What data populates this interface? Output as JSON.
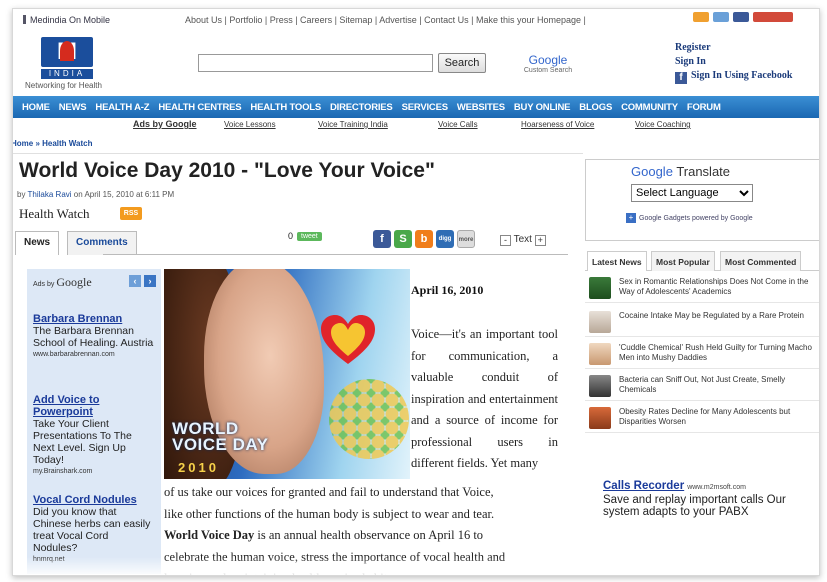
{
  "header": {
    "site_name": "Medindia On Mobile",
    "top_links": "About Us | Portfolio | Press | Careers | Sitemap | Advertise | Contact Us |  Make this your Homepage |",
    "logo_text": "M",
    "logo_country": "INDIA",
    "logo_tagline": "Networking for Health",
    "search_button": "Search",
    "custom_search_brand": "Google",
    "custom_search_label": "Custom Search",
    "register": "Register",
    "sign_in": "Sign In",
    "sign_in_facebook": "Sign In Using Facebook"
  },
  "nav": {
    "items": [
      "HOME",
      "NEWS",
      "HEALTH A-Z",
      "HEALTH CENTRES",
      "HEALTH TOOLS",
      "DIRECTORIES",
      "SERVICES",
      "WEBSITES",
      "BUY ONLINE",
      "BLOGS",
      "COMMUNITY",
      "FORUM"
    ]
  },
  "ad_links": {
    "label": "Ads by Google",
    "items": [
      "Voice Lessons",
      "Voice Training India",
      "Voice Calls",
      "Hoarseness of Voice",
      "Voice Coaching"
    ]
  },
  "breadcrumb": "Home » Health Watch",
  "article": {
    "title": "World Voice Day 2010 - \"Love Your Voice\"",
    "byline_prefix": "by ",
    "author": "Thilaka Ravi",
    "byline_suffix": " on  April 15, 2010 at 6:11 PM",
    "section": "Health Watch",
    "rss": "RSS",
    "tab_news": "News",
    "tab_comments": "Comments",
    "tweet_count": "0",
    "tweet_label": "tweet",
    "text_size_minus": "-",
    "text_size_label": "Text",
    "text_size_plus": "+",
    "date": "April 16, 2010",
    "para_narrow": "Voice—it's an important tool for communication, a valuable conduit of inspiration and entertainment and a source of income for professional users in different fields. Yet many",
    "para_wide_1": "of us take our voices for granted and fail to understand that Voice,",
    "para_wide_2": "like other functions of the human body is subject to wear and tear.",
    "para_wide_3_bold": "World Voice Day",
    "para_wide_3_rest": " is an annual health observance on April 16 to",
    "para_wide_4": "celebrate the human voice, stress the importance of vocal health and",
    "para_wide_5": "learning and maintaining healthy voice habits.",
    "hero_line1": "WORLD",
    "hero_line2": "VOICE DAY",
    "hero_year": "2010"
  },
  "ads_box": {
    "ads_by": "Ads by",
    "google": "Google",
    "ads": [
      {
        "headline": "Barbara Brennan",
        "desc": "The Barbara Brennan School of Healing. Austria",
        "url": "www.barbarabrennan.com"
      },
      {
        "headline": "Add Voice to Powerpoint",
        "desc": "Take Your Client Presentations To The Next Level. Sign Up Today!",
        "url": "my.Brainshark.com"
      },
      {
        "headline": "Vocal Cord Nodules",
        "desc": "Did you know that Chinese herbs can easily treat Vocal Cord Nodules?",
        "url": "hnmrq.net"
      }
    ]
  },
  "translate": {
    "brand": "Google",
    "label": "Translate",
    "select_value": "Select Language",
    "gadget_brand": "Google",
    "gadget_text": "Gadgets powered by Google"
  },
  "news_tabs": [
    "Latest News",
    "Most Popular",
    "Most Commented"
  ],
  "latest_news": [
    "Sex in Romantic Relationships Does Not Come in the Way of Adolescents' Academics",
    "Cocaine Intake May be Regulated by a Rare Protein",
    "'Cuddle Chemical' Rush Held Guilty for Turning Macho Men into Mushy Daddies",
    "Bacteria can Sniff Out, Not Just Create, Smelly Chemicals",
    "Obesity Rates Decline for Many Adolescents but Disparities Worsen"
  ],
  "side_ad": {
    "headline": "Calls Recorder",
    "url": "www.m2msoft.com",
    "desc": "Save and replay important calls Our system adapts to your PABX"
  },
  "colors": {
    "nav_blue": "#1a67b2",
    "link_blue": "#1a3a9a",
    "ads_bg": "#dde8f6",
    "rss_orange": "#f39b1f",
    "tweet_green": "#5cb85c"
  }
}
